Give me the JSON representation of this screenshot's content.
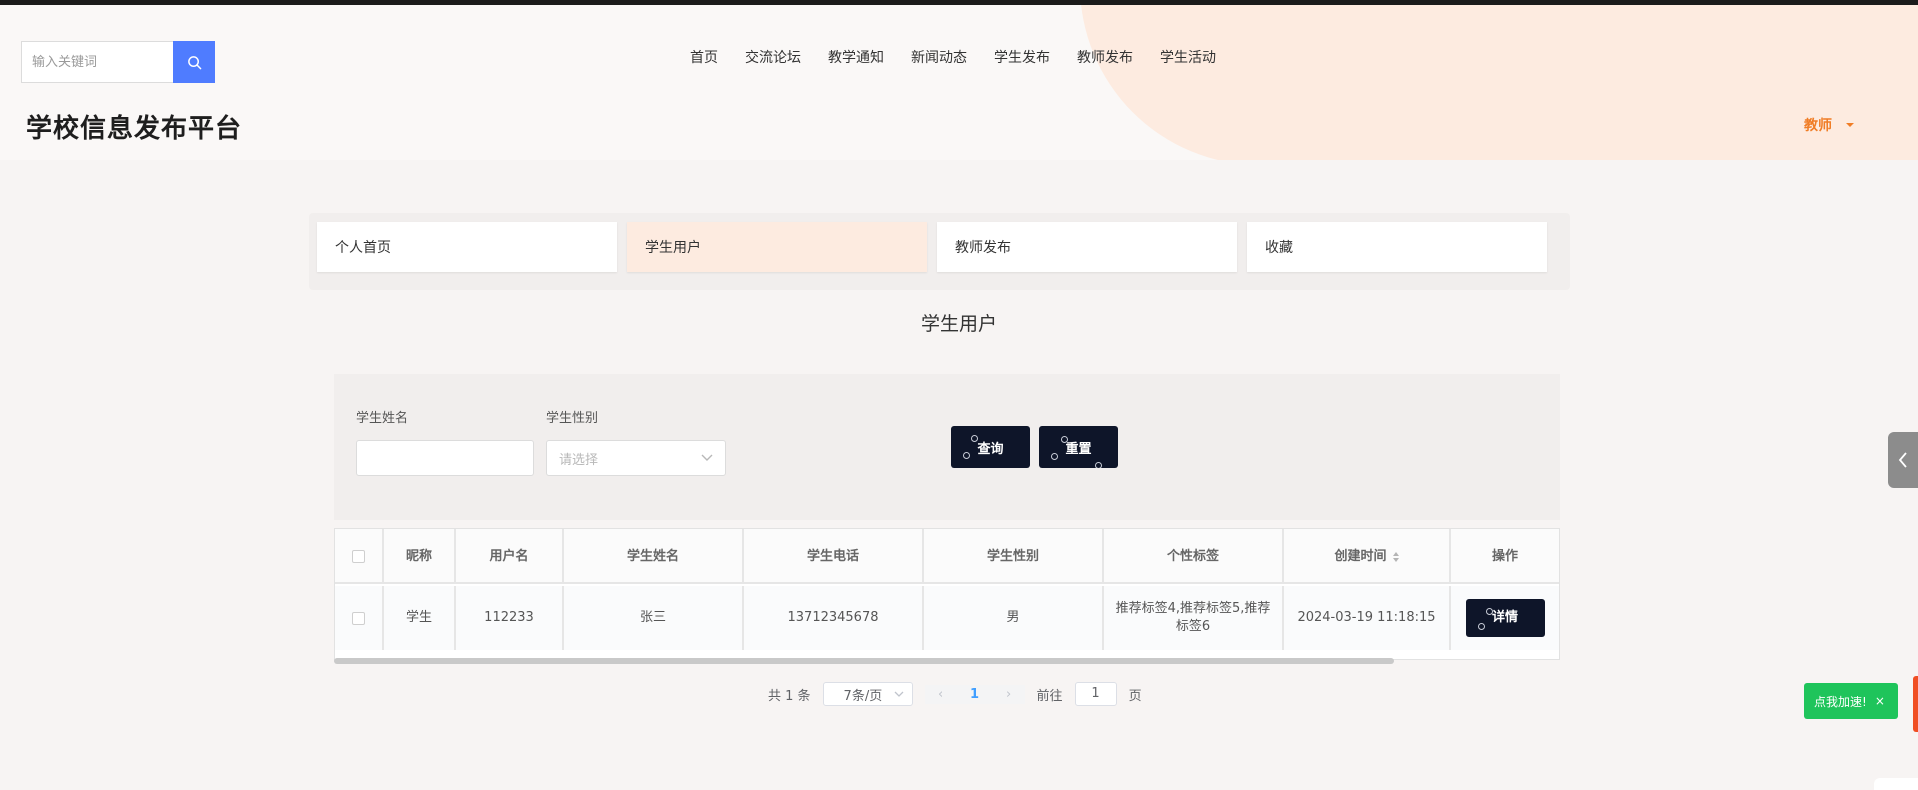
{
  "header": {
    "search_placeholder": "输入关键词",
    "site_title": "学校信息发布平台",
    "nav": [
      "首页",
      "交流论坛",
      "教学通知",
      "新闻动态",
      "学生发布",
      "教师发布",
      "学生活动"
    ],
    "role": "教师"
  },
  "tabs": [
    {
      "label": "个人首页",
      "active": false
    },
    {
      "label": "学生用户",
      "active": true
    },
    {
      "label": "教师发布",
      "active": false
    },
    {
      "label": "收藏",
      "active": false
    }
  ],
  "section_title": "学生用户",
  "filters": {
    "name_label": "学生姓名",
    "gender_label": "学生性别",
    "gender_placeholder": "请选择",
    "query_button": "查询",
    "reset_button": "重置"
  },
  "table": {
    "headers": [
      "昵称",
      "用户名",
      "学生姓名",
      "学生电话",
      "学生性别",
      "个性标签",
      "创建时间",
      "操作"
    ],
    "rows": [
      {
        "nickname": "学生",
        "username": "112233",
        "name": "张三",
        "phone": "13712345678",
        "gender": "男",
        "tags": "推荐标签4,推荐标签5,推荐标签6",
        "created": "2024-03-19 11:18:15",
        "action": "详情"
      }
    ]
  },
  "pagination": {
    "total_text": "共 1 条",
    "page_size": "7条/页",
    "current_page": "1",
    "goto_label": "前往",
    "goto_value": "1",
    "page_suffix": "页"
  },
  "floating": {
    "speed_button": "点我加速!",
    "speed_close": "×"
  },
  "colors": {
    "accent_blue": "#4f7cff",
    "role_orange": "#f07d26",
    "active_tab": "#fdebe0",
    "dark_button": "#0e1529",
    "speed_green": "#1fc45b"
  }
}
